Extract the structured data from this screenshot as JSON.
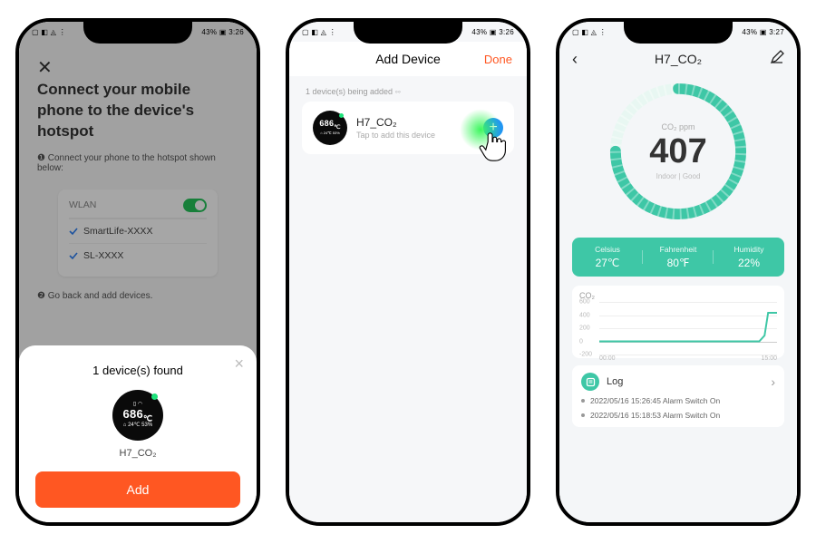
{
  "colors": {
    "accent_orange": "#ff5722",
    "accent_teal": "#3ec7a6",
    "accent_blue": "#2196f3"
  },
  "status": {
    "left_icons": "▢ ◧ ◬ ⋮",
    "right1": "43% ▣ 3:26",
    "right2": "43% ▣ 3:26",
    "right3": "43% ▣ 3:27"
  },
  "phone1": {
    "title": "Connect your mobile phone to the device's hotspot",
    "instruction": "❶ Connect your phone to the hotspot shown below:",
    "wlan_label": "WLAN",
    "wifi_options": [
      "SmartLife-XXXX",
      "SL-XXXX"
    ],
    "go_back": "❷ Go back and add devices.",
    "sheet": {
      "title": "1 device(s) found",
      "device_name": "H7_CO₂",
      "badge_value": "686",
      "badge_footer": "⌂ 24℃ 53%",
      "add_button": "Add"
    }
  },
  "phone2": {
    "header_title": "Add Device",
    "done": "Done",
    "being_added": "1 device(s) being added ◦◦",
    "device": {
      "name": "H7_CO₂",
      "subtitle": "Tap to add this device",
      "badge_value": "686",
      "badge_footer": "⌂ 24℃ 53%",
      "plus_icon": "plus-icon"
    }
  },
  "phone3": {
    "header_title": "H7_CO₂",
    "gauge": {
      "label": "CO₂ ppm",
      "value": "407",
      "quality": "Indoor | Good"
    },
    "metrics": [
      {
        "label": "Celsius",
        "value": "27℃"
      },
      {
        "label": "Fahrenheit",
        "value": "80℉"
      },
      {
        "label": "Humidity",
        "value": "22%"
      }
    ],
    "chart_label": "CO₂",
    "log_title": "Log",
    "log": [
      "2022/05/16 15:26:45 Alarm Switch On",
      "2022/05/16 15:18:53 Alarm Switch On"
    ]
  },
  "chart_data": {
    "type": "line",
    "title": "CO₂",
    "ylabel": "",
    "xlabel": "",
    "ylim": [
      -200,
      600
    ],
    "yticks": [
      -200,
      0,
      200,
      400,
      600
    ],
    "xticks": [
      "00:00",
      "15:00"
    ],
    "x": [
      "00:00",
      "14:30",
      "14:45",
      "14:50",
      "15:00"
    ],
    "values": [
      0,
      0,
      80,
      430,
      430
    ]
  }
}
